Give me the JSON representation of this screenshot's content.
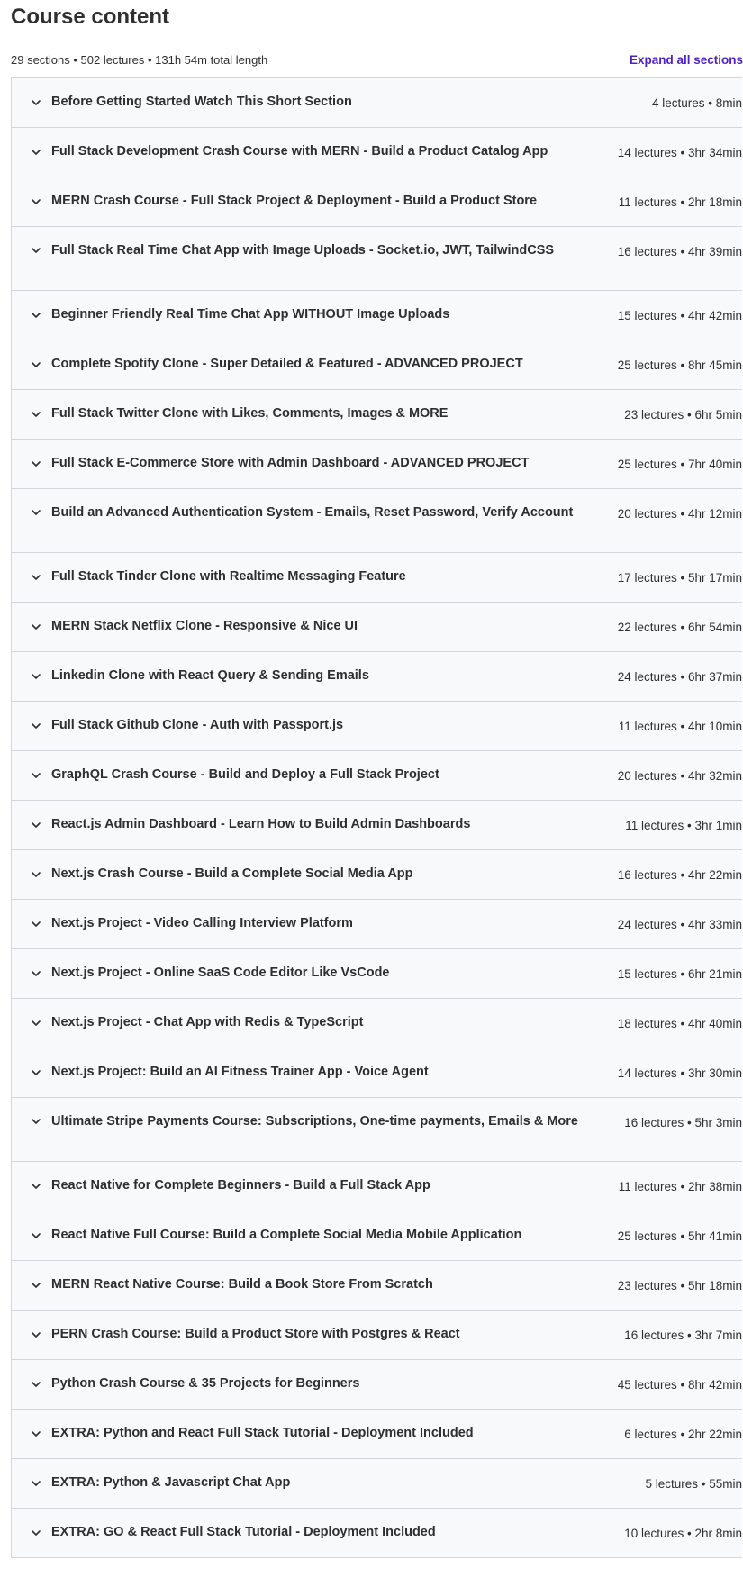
{
  "header": {
    "title": "Course content",
    "summary": "29 sections • 502 lectures • 131h 54m total length",
    "expand_all_label": "Expand all sections"
  },
  "icons": {
    "section_toggle": "chevron-down-icon"
  },
  "colors": {
    "accent": "#5022c3",
    "row_background": "#f7f9fa",
    "border": "#d1d7dc",
    "text": "#2d2f31"
  },
  "sections": [
    {
      "title": "Before Getting Started Watch This Short Section",
      "meta": "4 lectures • 8min"
    },
    {
      "title": "Full Stack Development Crash Course with MERN - Build a Product Catalog App",
      "meta": "14 lectures • 3hr 34min"
    },
    {
      "title": "MERN Crash Course - Full Stack Project & Deployment - Build a Product Store",
      "meta": "11 lectures • 2hr 18min"
    },
    {
      "title": "Full Stack Real Time Chat App with Image Uploads - Socket.io, JWT, TailwindCSS",
      "meta": "16 lectures • 4hr 39min"
    },
    {
      "title": "Beginner Friendly Real Time Chat App WITHOUT Image Uploads",
      "meta": "15 lectures • 4hr 42min"
    },
    {
      "title": "Complete Spotify Clone - Super Detailed & Featured - ADVANCED PROJECT",
      "meta": "25 lectures • 8hr 45min"
    },
    {
      "title": "Full Stack Twitter Clone with Likes, Comments, Images & MORE",
      "meta": "23 lectures • 6hr 5min"
    },
    {
      "title": "Full Stack E-Commerce Store with Admin Dashboard - ADVANCED PROJECT",
      "meta": "25 lectures • 7hr 40min"
    },
    {
      "title": "Build an Advanced Authentication System - Emails, Reset Password, Verify Account",
      "meta": "20 lectures • 4hr 12min"
    },
    {
      "title": "Full Stack Tinder Clone with Realtime Messaging Feature",
      "meta": "17 lectures • 5hr 17min"
    },
    {
      "title": "MERN Stack Netflix Clone - Responsive & Nice UI",
      "meta": "22 lectures • 6hr 54min"
    },
    {
      "title": "Linkedin Clone with React Query & Sending Emails",
      "meta": "24 lectures • 6hr 37min"
    },
    {
      "title": "Full Stack Github Clone - Auth with Passport.js",
      "meta": "11 lectures • 4hr 10min"
    },
    {
      "title": "GraphQL Crash Course - Build and Deploy a Full Stack Project",
      "meta": "20 lectures • 4hr 32min"
    },
    {
      "title": "React.js Admin Dashboard - Learn How to Build Admin Dashboards",
      "meta": "11 lectures • 3hr 1min"
    },
    {
      "title": "Next.js Crash Course - Build a Complete Social Media App",
      "meta": "16 lectures • 4hr 22min"
    },
    {
      "title": "Next.js Project - Video Calling Interview Platform",
      "meta": "24 lectures • 4hr 33min"
    },
    {
      "title": "Next.js Project - Online SaaS Code Editor Like VsCode",
      "meta": "15 lectures • 6hr 21min"
    },
    {
      "title": "Next.js Project - Chat App with Redis & TypeScript",
      "meta": "18 lectures • 4hr 40min"
    },
    {
      "title": "Next.js Project: Build an AI Fitness Trainer App - Voice Agent",
      "meta": "14 lectures • 3hr 30min"
    },
    {
      "title": "Ultimate Stripe Payments Course: Subscriptions, One-time payments, Emails & More",
      "meta": "16 lectures • 5hr 3min"
    },
    {
      "title": "React Native for Complete Beginners - Build a Full Stack App",
      "meta": "11 lectures • 2hr 38min"
    },
    {
      "title": "React Native Full Course: Build a Complete Social Media Mobile Application",
      "meta": "25 lectures • 5hr 41min"
    },
    {
      "title": "MERN React Native Course: Build a Book Store From Scratch",
      "meta": "23 lectures • 5hr 18min"
    },
    {
      "title": "PERN Crash Course: Build a Product Store with Postgres & React",
      "meta": "16 lectures • 3hr 7min"
    },
    {
      "title": "Python Crash Course & 35 Projects for Beginners",
      "meta": "45 lectures • 8hr 42min"
    },
    {
      "title": "EXTRA: Python and React Full Stack Tutorial - Deployment Included",
      "meta": "6 lectures • 2hr 22min"
    },
    {
      "title": "EXTRA: Python & Javascript Chat App",
      "meta": "5 lectures • 55min"
    },
    {
      "title": "EXTRA: GO & React Full Stack Tutorial - Deployment Included",
      "meta": "10 lectures • 2hr 8min"
    }
  ]
}
